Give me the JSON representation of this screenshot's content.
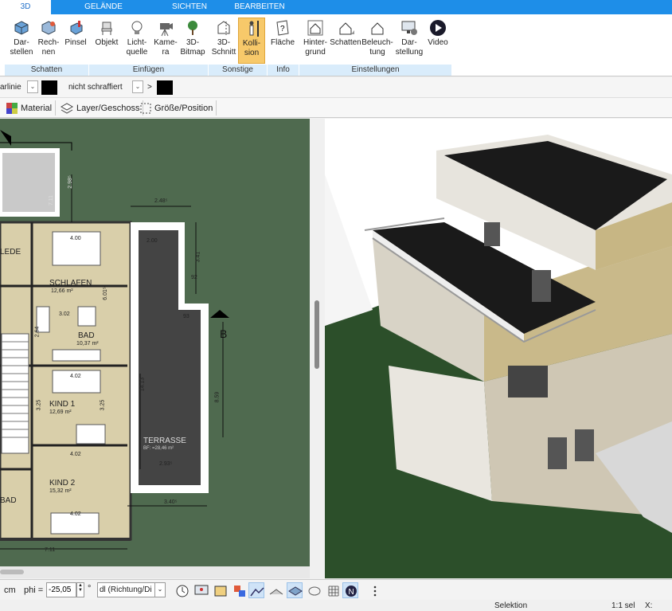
{
  "tabs": [
    "3D",
    "GELÄNDE",
    "SICHTEN",
    "BEARBEITEN"
  ],
  "ribbon": {
    "buttons": [
      {
        "l1": "Dar-",
        "l2": "stellen",
        "icon": "cube-display-icon"
      },
      {
        "l1": "Rech-",
        "l2": "nen",
        "icon": "cube-render-icon"
      },
      {
        "l1": "Pinsel",
        "l2": "",
        "icon": "brush-icon"
      },
      {
        "l1": "Objekt",
        "l2": "",
        "icon": "chair-icon"
      },
      {
        "l1": "Licht-",
        "l2": "quelle",
        "icon": "bulb-icon"
      },
      {
        "l1": "Kame-",
        "l2": "ra",
        "icon": "camera-icon"
      },
      {
        "l1": "3D-",
        "l2": "Bitmap",
        "icon": "tree-icon"
      },
      {
        "l1": "3D-",
        "l2": "Schnitt",
        "icon": "section-icon"
      },
      {
        "l1": "Kolli-",
        "l2": "sion",
        "icon": "person-icon"
      },
      {
        "l1": "Fläche",
        "l2": "",
        "icon": "area-info-icon"
      },
      {
        "l1": "Hinter-",
        "l2": "grund",
        "icon": "house-background-icon"
      },
      {
        "l1": "Schatten",
        "l2": "",
        "icon": "house-shadow-icon"
      },
      {
        "l1": "Beleuch-",
        "l2": "tung",
        "icon": "house-light-icon"
      },
      {
        "l1": "Dar-",
        "l2": "stellung",
        "icon": "monitor-settings-icon"
      },
      {
        "l1": "Video",
        "l2": "",
        "icon": "play-icon"
      }
    ],
    "groups": [
      "Schatten",
      "Einfügen",
      "Sonstige",
      "Info",
      "Einstellungen"
    ]
  },
  "toolbar2": {
    "line_label": "arlinie",
    "hatch_label": "nicht schraffiert",
    "arrow": ">"
  },
  "toolbar3": {
    "material": "Material",
    "layer": "Layer/Geschoss",
    "size": "Größe/Position"
  },
  "plan": {
    "rooms": [
      {
        "name": "SCHLAFEN",
        "area": "12,66 m²"
      },
      {
        "name": "BAD",
        "area": "10,37 m²"
      },
      {
        "name": "KIND 1",
        "area": "12,69 m²"
      },
      {
        "name": "KIND 2",
        "area": "15,32 m²"
      },
      {
        "name": "TERRASSE",
        "area": "BF: =28,46 m²"
      },
      {
        "name": "LEDE",
        "area": ""
      },
      {
        "name": "BAD",
        "area": ""
      }
    ],
    "dims": [
      "2.48⁵",
      "3.41",
      "2.00",
      "4.00",
      "3.02",
      "4.02",
      "4.02",
      "4.02",
      "3.25",
      "3.25",
      "14.13",
      "8.59",
      "2.93⁵",
      "3.40⁵",
      "7.11",
      "7.11",
      "2.98⁵",
      "6.01⁵",
      "2.64",
      "92",
      "93"
    ],
    "section_label": "B"
  },
  "bottom": {
    "unit": "cm",
    "phi_label": "phi =",
    "phi_value": "-25,05",
    "deg": "°",
    "dl_value": "dl (Richtung/Di"
  },
  "status": {
    "selection": "Selektion",
    "scale": "1:1 sel",
    "x": "X:"
  },
  "colors": {
    "accent": "#1e8ee8",
    "active": "#f7c96a",
    "ground": "#4f6a4f",
    "grass3d": "#2c4f2a"
  }
}
